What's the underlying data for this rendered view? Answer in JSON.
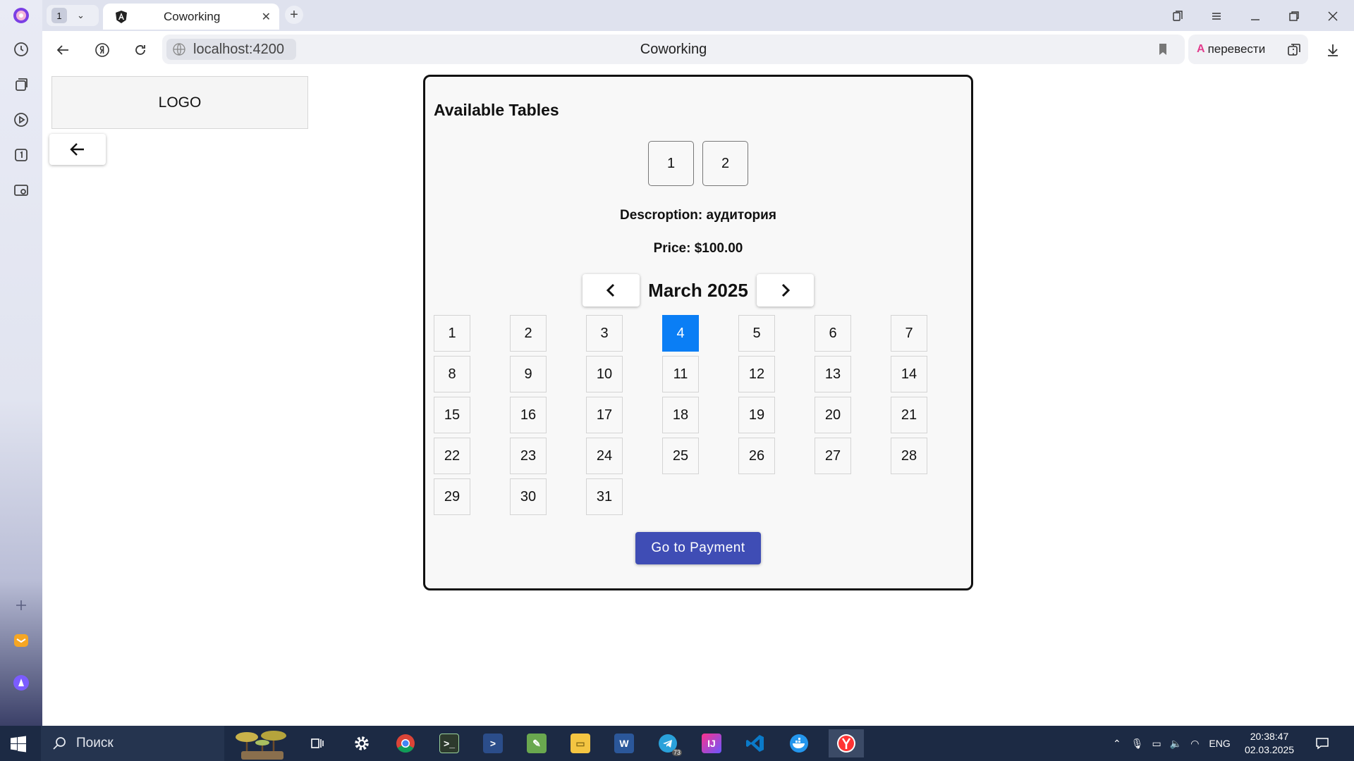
{
  "browser": {
    "tab_count": "1",
    "tab_title": "Coworking",
    "url": "localhost:4200",
    "page_title": "Coworking",
    "translate_label": "перевести"
  },
  "page": {
    "logo": "LOGO",
    "card_title": "Available Tables",
    "tables": [
      "1",
      "2"
    ],
    "description": "Descroption: аудитория",
    "price": "Price: $100.00",
    "month": "March 2025",
    "days": [
      "1",
      "2",
      "3",
      "4",
      "5",
      "6",
      "7",
      "8",
      "9",
      "10",
      "11",
      "12",
      "13",
      "14",
      "15",
      "16",
      "17",
      "18",
      "19",
      "20",
      "21",
      "22",
      "23",
      "24",
      "25",
      "26",
      "27",
      "28",
      "29",
      "30",
      "31"
    ],
    "selected_day": "4",
    "pay_button": "Go to Payment",
    "selected_color": "#0a7ef5",
    "pay_color": "#3f4db5"
  },
  "taskbar": {
    "search_label": "Поиск",
    "language": "ENG",
    "time": "20:38:47",
    "date": "02.03.2025",
    "telegram_badge": "73"
  }
}
